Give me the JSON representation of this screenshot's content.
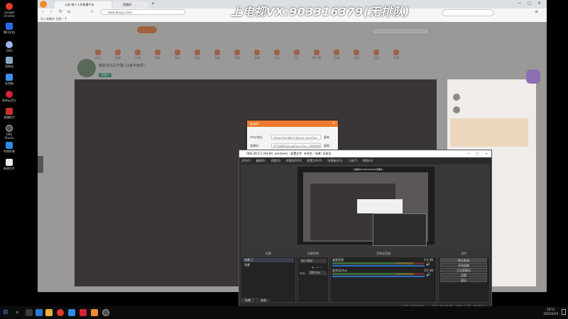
{
  "overlay_title": "上电视VX:903316379(无排队)",
  "desktop": {
    "icons": [
      {
        "label": "Google Chrome",
        "color": "#e33b2e"
      },
      {
        "label": "腾讯文档",
        "color": "#2b6be3"
      },
      {
        "label": "DVD",
        "color": "#9bb5e8"
      },
      {
        "label": "回收站",
        "color": "#8aa7c7"
      },
      {
        "label": "此电脑",
        "color": "#3d8fe6"
      },
      {
        "label": "网易云音乐",
        "color": "#d6223a"
      },
      {
        "label": "直播助手",
        "color": "#c8312f"
      },
      {
        "label": "OBS Studio",
        "color": "#505050"
      },
      {
        "label": "哔哩哔哩",
        "color": "#2f8ae0"
      },
      {
        "label": "新建文件",
        "color": "#e8e8e8"
      }
    ]
  },
  "browser": {
    "tabs": [
      {
        "label": "斗鱼-每个人的直播平台"
      },
      {
        "label": "直播间"
      }
    ],
    "url": "www.douyu.com/",
    "bookmarks_text": "导入收藏夹  百度一下",
    "site": {
      "nav_items": [
        "首页",
        "直播",
        "分类",
        "游戏",
        "娱乐",
        "科技",
        "鱼吧",
        "视频",
        "赛事",
        "活动",
        "排行",
        "客户端",
        "鱼塘",
        "商城",
        "充值",
        "开播"
      ],
      "anchor_name": "颠颠日头间卡路:11级半夜爱!",
      "live_badge": "直播中"
    }
  },
  "dialog": {
    "title": "推流码",
    "rows": [
      {
        "label": "rtmp地址",
        "value": "rtmp://sendtc3.douyu.com/live",
        "action": "复制"
      },
      {
        "label": "直播码",
        "value": "9732865&lnwkGmn?ex=1600000",
        "action": "复制"
      }
    ]
  },
  "obs": {
    "title": "OBS 28.0.1 (64-bit, windows) - 配置文件: 未命名 - 场景: 未命名",
    "menu": [
      "文件(F)",
      "编辑(E)",
      "视图(V)",
      "停靠部件(D)",
      "配置文件(P)",
      "场景集合(S)",
      "工具(T)",
      "帮助(H)"
    ],
    "docks": [
      "场景",
      "来源",
      "音频混音器",
      "场景转换",
      "控件"
    ],
    "scenes": [
      "场景 2",
      "场景"
    ],
    "transition": {
      "label": "淡入淡出",
      "duration_label": "时长",
      "duration": "300 ms"
    },
    "mixer": [
      {
        "name": "桌面音频",
        "db": "0.0 dB"
      },
      {
        "name": "麦克风/Aux",
        "db": "0.0 dB"
      }
    ],
    "controls": [
      "停止推流",
      "开始录制",
      "工作室模式",
      "设置",
      "退出"
    ],
    "bottom_tabs": [
      "场景",
      "来源"
    ],
    "status": {
      "live": "LIVE: 00:00:03",
      "rec": "REC: 00:00:00",
      "cpu": "CPU: 3.4%, 30.00 fps"
    }
  },
  "taskbar": {
    "time": "19:51",
    "date": "2022/2/24"
  }
}
